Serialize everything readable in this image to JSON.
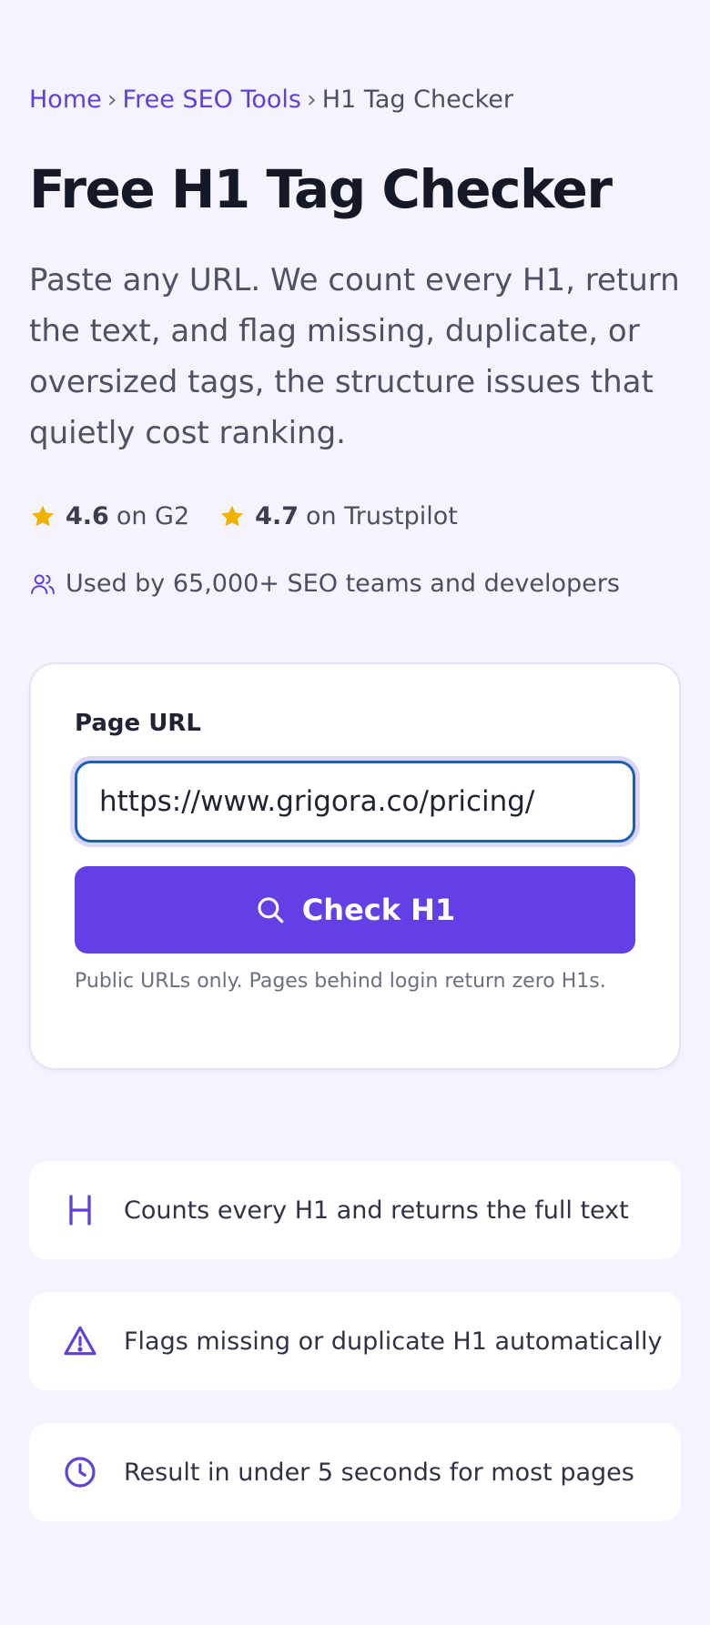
{
  "breadcrumb": {
    "home": "Home",
    "tools": "Free SEO Tools",
    "current": "H1 Tag Checker",
    "separator": "›"
  },
  "page": {
    "title": "Free H1 Tag Checker",
    "lede": "Paste any URL. We count every H1, return the text, and flag missing, duplicate, or oversized tags, the structure issues that quietly cost ranking."
  },
  "ratings": [
    {
      "score": "4.6",
      "source": "on G2"
    },
    {
      "score": "4.7",
      "source": "on Trustpilot"
    }
  ],
  "social_proof": "Used by 65,000+ SEO teams and developers",
  "form": {
    "label": "Page URL",
    "url_value": "https://www.grigora.co/pricing/",
    "button_label": "Check H1",
    "note": "Public URLs only. Pages behind login return zero H1s."
  },
  "features": [
    {
      "icon": "heading-icon",
      "text": "Counts every H1 and returns the full text"
    },
    {
      "icon": "warning-icon",
      "text": "Flags missing or duplicate H1 automatically"
    },
    {
      "icon": "clock-icon",
      "text": "Result in under 5 seconds for most pages"
    }
  ],
  "colors": {
    "background": "#f5f3fe",
    "accent": "#6240e6",
    "link": "#6240d8",
    "star": "#f0b400",
    "input_focus": "#1b5fb6"
  }
}
